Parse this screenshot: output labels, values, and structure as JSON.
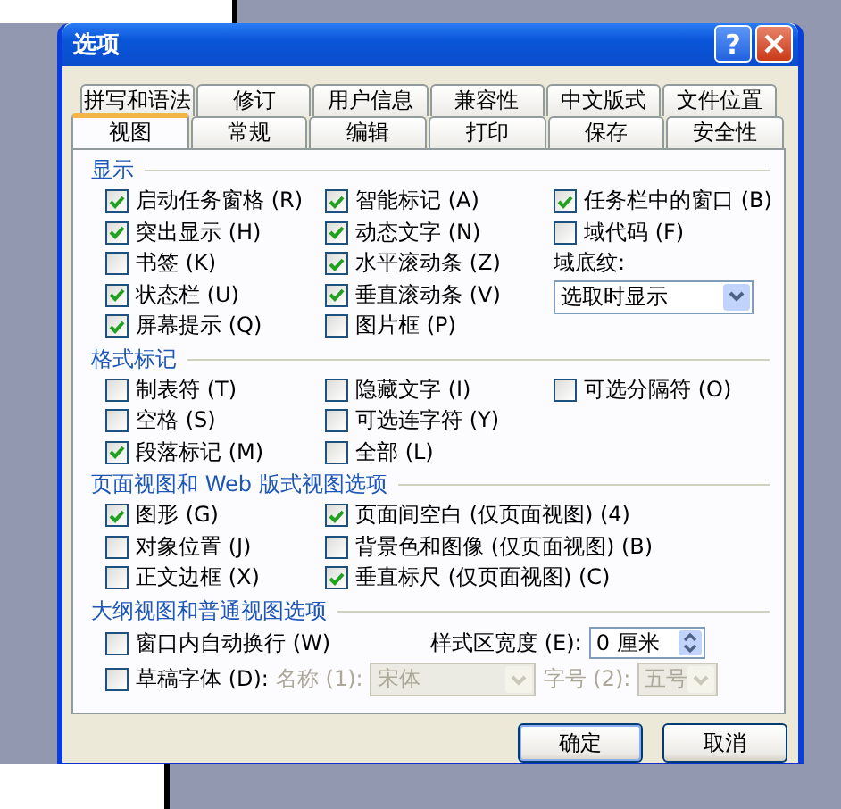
{
  "window": {
    "title": "选项",
    "help_button": "?"
  },
  "tab_rows": [
    [
      {
        "label": "拼写和语法",
        "selected": false
      },
      {
        "label": "修订",
        "selected": false
      },
      {
        "label": "用户信息",
        "selected": false
      },
      {
        "label": "兼容性",
        "selected": false
      },
      {
        "label": "中文版式",
        "selected": false
      },
      {
        "label": "文件位置",
        "selected": false
      }
    ],
    [
      {
        "label": "视图",
        "selected": true
      },
      {
        "label": "常规",
        "selected": false
      },
      {
        "label": "编辑",
        "selected": false
      },
      {
        "label": "打印",
        "selected": false
      },
      {
        "label": "保存",
        "selected": false
      },
      {
        "label": "安全性",
        "selected": false
      }
    ]
  ],
  "sections": [
    {
      "title": "显示",
      "kind": "columns",
      "columns": [
        [
          {
            "kind": "checkbox",
            "label": "启动任务窗格 (R)",
            "checked": true
          },
          {
            "kind": "checkbox",
            "label": "突出显示 (H)",
            "checked": true
          },
          {
            "kind": "checkbox",
            "label": "书签 (K)",
            "checked": false
          },
          {
            "kind": "checkbox",
            "label": "状态栏 (U)",
            "checked": true
          },
          {
            "kind": "checkbox",
            "label": "屏幕提示 (Q)",
            "checked": true
          }
        ],
        [
          {
            "kind": "checkbox",
            "label": "智能标记 (A)",
            "checked": true
          },
          {
            "kind": "checkbox",
            "label": "动态文字 (N)",
            "checked": true
          },
          {
            "kind": "checkbox",
            "label": "水平滚动条 (Z)",
            "checked": true
          },
          {
            "kind": "checkbox",
            "label": "垂直滚动条 (V)",
            "checked": true
          },
          {
            "kind": "checkbox",
            "label": "图片框 (P)",
            "checked": false
          }
        ],
        [
          {
            "kind": "checkbox",
            "label": "任务栏中的窗口 (B)",
            "checked": true
          },
          {
            "kind": "checkbox",
            "label": "域代码 (F)",
            "checked": false
          },
          {
            "kind": "label",
            "label": "域底纹:",
            "disabled": false
          },
          {
            "kind": "dropdown",
            "value": "选取时显示",
            "disabled": false
          }
        ]
      ]
    },
    {
      "title": "格式标记",
      "kind": "columns",
      "columns": [
        [
          {
            "kind": "checkbox",
            "label": "制表符 (T)",
            "checked": false
          },
          {
            "kind": "checkbox",
            "label": "空格 (S)",
            "checked": false
          },
          {
            "kind": "checkbox",
            "label": "段落标记 (M)",
            "checked": true
          }
        ],
        [
          {
            "kind": "checkbox",
            "label": "隐藏文字 (I)",
            "checked": false
          },
          {
            "kind": "checkbox",
            "label": "可选连字符 (Y)",
            "checked": false
          },
          {
            "kind": "checkbox",
            "label": "全部 (L)",
            "checked": false
          }
        ],
        [
          {
            "kind": "checkbox",
            "label": "可选分隔符 (O)",
            "checked": false
          }
        ]
      ]
    },
    {
      "title": "页面视图和 Web 版式视图选项",
      "kind": "columns",
      "columns": [
        [
          {
            "kind": "checkbox",
            "label": "图形 (G)",
            "checked": true
          },
          {
            "kind": "checkbox",
            "label": "对象位置 (J)",
            "checked": false
          },
          {
            "kind": "checkbox",
            "label": "正文边框 (X)",
            "checked": false
          }
        ],
        [
          {
            "kind": "checkbox",
            "label": "页面间空白 (仅页面视图) (4)",
            "checked": true
          },
          {
            "kind": "checkbox",
            "label": "背景色和图像 (仅页面视图) (B)",
            "checked": false
          },
          {
            "kind": "checkbox",
            "label": "垂直标尺 (仅页面视图) (C)",
            "checked": true
          }
        ]
      ]
    },
    {
      "title": "大纲视图和普通视图选项",
      "kind": "outline",
      "wrap_option": {
        "kind": "checkbox",
        "label": "窗口内自动换行 (W)",
        "checked": false
      },
      "style_area_width": {
        "label": {
          "kind": "label",
          "label": "样式区宽度 (E):",
          "disabled": false
        },
        "spinner": {
          "kind": "spinner",
          "value": "0 厘米"
        }
      },
      "draft_font": {
        "checkbox": {
          "kind": "checkbox",
          "label": "草稿字体 (D):",
          "checked": false
        },
        "name_label": {
          "kind": "label",
          "label": "名称 (1):",
          "disabled": true
        },
        "name_dropdown": {
          "kind": "dropdown",
          "value": "宋体",
          "disabled": true
        },
        "size_label": {
          "kind": "label",
          "label": "字号 (2):",
          "disabled": true
        },
        "size_dropdown": {
          "kind": "dropdown",
          "value": "五号",
          "disabled": true
        }
      }
    }
  ],
  "buttons": [
    "确定",
    "取消"
  ]
}
